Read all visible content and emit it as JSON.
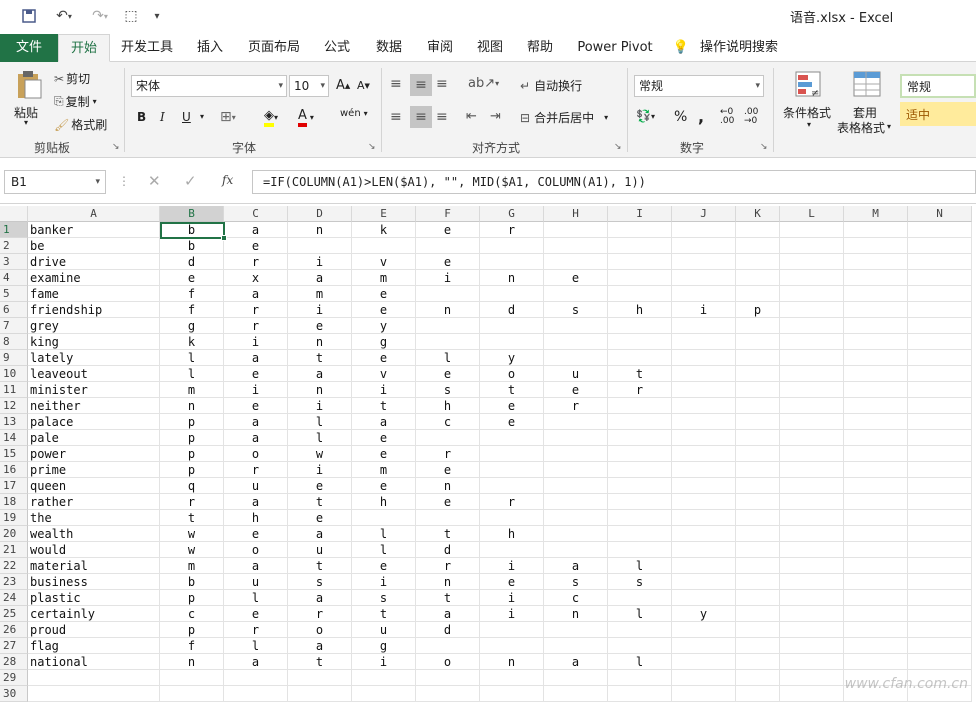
{
  "window": {
    "title": "语音.xlsx  -  Excel"
  },
  "tabs": [
    "文件",
    "开始",
    "开发工具",
    "插入",
    "页面布局",
    "公式",
    "数据",
    "审阅",
    "视图",
    "帮助",
    "Power Pivot",
    "操作说明搜索"
  ],
  "ribbon": {
    "clipboard": {
      "paste": "粘贴",
      "cut": "剪切",
      "copy": "复制",
      "format_painter": "格式刷",
      "label": "剪贴板"
    },
    "font": {
      "name": "宋体",
      "size": "10",
      "label": "字体",
      "bold": "B",
      "italic": "I",
      "underline": "U"
    },
    "align": {
      "wrap": "自动换行",
      "merge": "合并后居中",
      "label": "对齐方式"
    },
    "number": {
      "format": "常规",
      "percent": "%",
      "comma": ",",
      "label": "数字"
    },
    "styles": {
      "cond": "条件格式",
      "table1": "套用",
      "table2": "表格格式",
      "normal": "常规",
      "neutral": "适中"
    }
  },
  "namebox": "B1",
  "fx": "fx",
  "formula": "=IF(COLUMN(A1)>LEN($A1), \"\", MID($A1, COLUMN(A1), 1))",
  "columns": [
    "A",
    "B",
    "C",
    "D",
    "E",
    "F",
    "G",
    "H",
    "I",
    "J",
    "K",
    "L",
    "M",
    "N"
  ],
  "rows": [
    [
      "banker",
      "b",
      "a",
      "n",
      "k",
      "e",
      "r"
    ],
    [
      "be",
      "b",
      "e"
    ],
    [
      "drive",
      "d",
      "r",
      "i",
      "v",
      "e"
    ],
    [
      "examine",
      "e",
      "x",
      "a",
      "m",
      "i",
      "n",
      "e"
    ],
    [
      "fame",
      "f",
      "a",
      "m",
      "e"
    ],
    [
      "friendship",
      "f",
      "r",
      "i",
      "e",
      "n",
      "d",
      "s",
      "h",
      "i",
      "p"
    ],
    [
      "grey",
      "g",
      "r",
      "e",
      "y"
    ],
    [
      "king",
      "k",
      "i",
      "n",
      "g"
    ],
    [
      "lately",
      "l",
      "a",
      "t",
      "e",
      "l",
      "y"
    ],
    [
      "leaveout",
      "l",
      "e",
      "a",
      "v",
      "e",
      "o",
      "u",
      "t"
    ],
    [
      "minister",
      "m",
      "i",
      "n",
      "i",
      "s",
      "t",
      "e",
      "r"
    ],
    [
      "neither",
      "n",
      "e",
      "i",
      "t",
      "h",
      "e",
      "r"
    ],
    [
      "palace",
      "p",
      "a",
      "l",
      "a",
      "c",
      "e"
    ],
    [
      "pale",
      "p",
      "a",
      "l",
      "e"
    ],
    [
      "power",
      "p",
      "o",
      "w",
      "e",
      "r"
    ],
    [
      "prime",
      "p",
      "r",
      "i",
      "m",
      "e"
    ],
    [
      "queen",
      "q",
      "u",
      "e",
      "e",
      "n"
    ],
    [
      "rather",
      "r",
      "a",
      "t",
      "h",
      "e",
      "r"
    ],
    [
      "the",
      "t",
      "h",
      "e"
    ],
    [
      "wealth",
      "w",
      "e",
      "a",
      "l",
      "t",
      "h"
    ],
    [
      "would",
      "w",
      "o",
      "u",
      "l",
      "d"
    ],
    [
      "material",
      "m",
      "a",
      "t",
      "e",
      "r",
      "i",
      "a",
      "l"
    ],
    [
      "business",
      "b",
      "u",
      "s",
      "i",
      "n",
      "e",
      "s",
      "s"
    ],
    [
      "plastic",
      "p",
      "l",
      "a",
      "s",
      "t",
      "i",
      "c"
    ],
    [
      "certainly",
      "c",
      "e",
      "r",
      "t",
      "a",
      "i",
      "n",
      "l",
      "y"
    ],
    [
      "proud",
      "p",
      "r",
      "o",
      "u",
      "d"
    ],
    [
      "flag",
      "f",
      "l",
      "a",
      "g"
    ],
    [
      "national",
      "n",
      "a",
      "t",
      "i",
      "o",
      "n",
      "a",
      "l"
    ],
    [],
    []
  ],
  "watermark": "www.cfan.com.cn",
  "colors": {
    "accent": "#217346",
    "neutral_fill": "#ffeb9c",
    "neutral_text": "#9c5700"
  }
}
